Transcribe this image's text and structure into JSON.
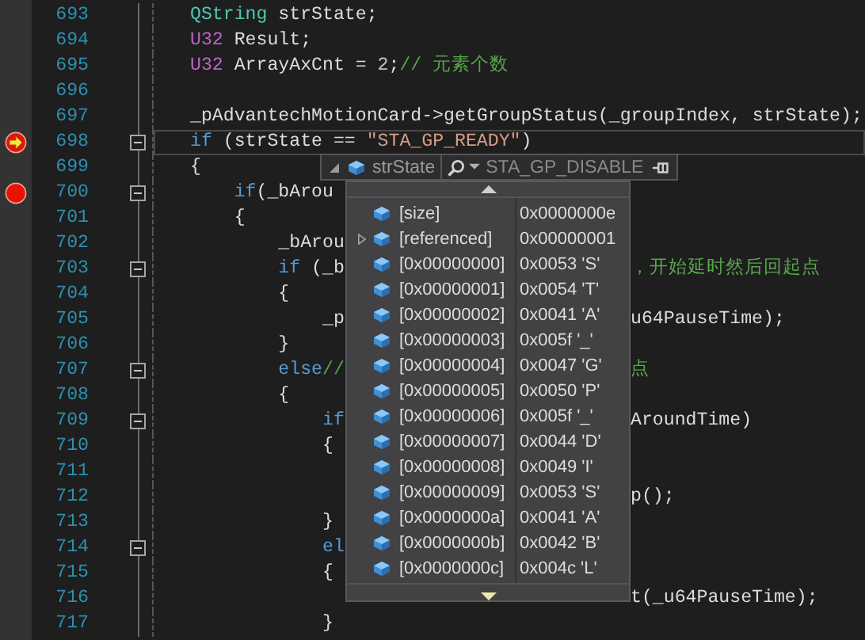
{
  "editor": {
    "lines": [
      {
        "number": "693",
        "current": false,
        "breakpoint": false,
        "highlighted": false,
        "foldable": false,
        "tokens": [
          {
            "kind": "type",
            "text": "QString"
          },
          {
            "kind": "plain",
            "text": " strState;"
          }
        ]
      },
      {
        "number": "694",
        "current": false,
        "breakpoint": false,
        "highlighted": false,
        "foldable": false,
        "tokens": [
          {
            "kind": "macro",
            "text": "U32"
          },
          {
            "kind": "plain",
            "text": " Result;"
          }
        ]
      },
      {
        "number": "695",
        "current": false,
        "breakpoint": false,
        "highlighted": false,
        "foldable": false,
        "tokens": [
          {
            "kind": "macro",
            "text": "U32"
          },
          {
            "kind": "plain",
            "text": " ArrayAxCnt = "
          },
          {
            "kind": "number",
            "text": "2"
          },
          {
            "kind": "plain",
            "text": ";"
          },
          {
            "kind": "comment",
            "text": "// 元素个数"
          }
        ]
      },
      {
        "number": "696",
        "current": false,
        "breakpoint": false,
        "highlighted": false,
        "foldable": false
      },
      {
        "number": "697",
        "current": false,
        "breakpoint": false,
        "highlighted": false,
        "foldable": false,
        "tokens": [
          {
            "kind": "plain",
            "text": "_pAdvantechMotionCard->getGroupStatus(_groupIndex, strState);"
          }
        ]
      },
      {
        "number": "698",
        "current": true,
        "breakpoint": true,
        "highlighted": true,
        "foldable": true,
        "tokens": [
          {
            "kind": "keyword",
            "text": "if"
          },
          {
            "kind": "plain",
            "text": " (strState == "
          },
          {
            "kind": "string",
            "text": "\"STA_GP_READY\""
          },
          {
            "kind": "plain",
            "text": ")"
          }
        ]
      },
      {
        "number": "699",
        "current": false,
        "breakpoint": false,
        "highlighted": false,
        "foldable": false,
        "tokens": [
          {
            "kind": "plain",
            "text": "{"
          }
        ]
      },
      {
        "number": "700",
        "current": false,
        "breakpoint": true,
        "highlighted": false,
        "foldable": true,
        "tokens": [
          {
            "kind": "keyword",
            "text": "    if"
          },
          {
            "kind": "plain",
            "text": "(_bArou"
          }
        ]
      },
      {
        "number": "701",
        "current": false,
        "breakpoint": false,
        "highlighted": false,
        "foldable": false,
        "tokens": [
          {
            "kind": "plain",
            "text": "    {"
          }
        ]
      },
      {
        "number": "702",
        "current": false,
        "breakpoint": false,
        "highlighted": false,
        "foldable": false,
        "tokens": [
          {
            "kind": "plain",
            "text": "        _bArou"
          }
        ]
      },
      {
        "number": "703",
        "current": false,
        "breakpoint": false,
        "highlighted": false,
        "foldable": true,
        "tokens": [
          {
            "kind": "keyword",
            "text": "        if"
          },
          {
            "kind": "plain",
            "text": " (_b"
          }
        ],
        "tail": [
          {
            "kind": "comment",
            "text": "，开始延时然后回起点"
          }
        ]
      },
      {
        "number": "704",
        "current": false,
        "breakpoint": false,
        "highlighted": false,
        "foldable": false,
        "tokens": [
          {
            "kind": "plain",
            "text": "        {"
          }
        ]
      },
      {
        "number": "705",
        "current": false,
        "breakpoint": false,
        "highlighted": false,
        "foldable": false,
        "tokens": [
          {
            "kind": "plain",
            "text": "            _p"
          }
        ],
        "tail": [
          {
            "kind": "plain",
            "text": "u64PauseTime);"
          }
        ]
      },
      {
        "number": "706",
        "current": false,
        "breakpoint": false,
        "highlighted": false,
        "foldable": false,
        "tokens": [
          {
            "kind": "plain",
            "text": "        }"
          }
        ]
      },
      {
        "number": "707",
        "current": false,
        "breakpoint": false,
        "highlighted": false,
        "foldable": true,
        "tokens": [
          {
            "kind": "keyword",
            "text": "        else"
          },
          {
            "kind": "comment",
            "text": "//"
          }
        ],
        "tail": [
          {
            "kind": "comment",
            "text": "点"
          }
        ]
      },
      {
        "number": "708",
        "current": false,
        "breakpoint": false,
        "highlighted": false,
        "foldable": false,
        "tokens": [
          {
            "kind": "plain",
            "text": "        {"
          }
        ]
      },
      {
        "number": "709",
        "current": false,
        "breakpoint": false,
        "highlighted": false,
        "foldable": true,
        "tokens": [
          {
            "kind": "keyword",
            "text": "            if"
          }
        ],
        "tail": [
          {
            "kind": "plain",
            "text": "AroundTime)"
          }
        ]
      },
      {
        "number": "710",
        "current": false,
        "breakpoint": false,
        "highlighted": false,
        "foldable": false,
        "tokens": [
          {
            "kind": "plain",
            "text": "            {"
          }
        ]
      },
      {
        "number": "711",
        "current": false,
        "breakpoint": false,
        "highlighted": false,
        "foldable": false
      },
      {
        "number": "712",
        "current": false,
        "breakpoint": false,
        "highlighted": false,
        "foldable": false,
        "tail": [
          {
            "kind": "plain",
            "text": "p();"
          }
        ]
      },
      {
        "number": "713",
        "current": false,
        "breakpoint": false,
        "highlighted": false,
        "foldable": false,
        "tokens": [
          {
            "kind": "plain",
            "text": "            }"
          }
        ]
      },
      {
        "number": "714",
        "current": false,
        "breakpoint": false,
        "highlighted": false,
        "foldable": true,
        "tokens": [
          {
            "kind": "keyword",
            "text": "            el"
          }
        ]
      },
      {
        "number": "715",
        "current": false,
        "breakpoint": false,
        "highlighted": false,
        "foldable": false,
        "tokens": [
          {
            "kind": "plain",
            "text": "            {"
          }
        ]
      },
      {
        "number": "716",
        "current": false,
        "breakpoint": false,
        "highlighted": false,
        "foldable": false,
        "tail": [
          {
            "kind": "plain",
            "text": "t(_u64PauseTime);"
          }
        ]
      },
      {
        "number": "717",
        "current": false,
        "breakpoint": false,
        "highlighted": false,
        "foldable": false,
        "tokens": [
          {
            "kind": "plain",
            "text": "            }"
          }
        ]
      }
    ]
  },
  "datatip": {
    "expression": "strState",
    "value": "STA_GP_DISABLE",
    "items": [
      {
        "name": "[size]",
        "value": "0x0000000e",
        "expandable": false
      },
      {
        "name": "[referenced]",
        "value": "0x00000001",
        "expandable": true
      },
      {
        "name": "[0x00000000]",
        "value": "0x0053 'S'",
        "expandable": false
      },
      {
        "name": "[0x00000001]",
        "value": "0x0054 'T'",
        "expandable": false
      },
      {
        "name": "[0x00000002]",
        "value": "0x0041 'A'",
        "expandable": false
      },
      {
        "name": "[0x00000003]",
        "value": "0x005f '_'",
        "expandable": false
      },
      {
        "name": "[0x00000004]",
        "value": "0x0047 'G'",
        "expandable": false
      },
      {
        "name": "[0x00000005]",
        "value": "0x0050 'P'",
        "expandable": false
      },
      {
        "name": "[0x00000006]",
        "value": "0x005f '_'",
        "expandable": false
      },
      {
        "name": "[0x00000007]",
        "value": "0x0044 'D'",
        "expandable": false
      },
      {
        "name": "[0x00000008]",
        "value": "0x0049 'I'",
        "expandable": false
      },
      {
        "name": "[0x00000009]",
        "value": "0x0053 'S'",
        "expandable": false
      },
      {
        "name": "[0x0000000a]",
        "value": "0x0041 'A'",
        "expandable": false
      },
      {
        "name": "[0x0000000b]",
        "value": "0x0042 'B'",
        "expandable": false
      },
      {
        "name": "[0x0000000c]",
        "value": "0x004c 'L'",
        "expandable": false
      }
    ]
  }
}
